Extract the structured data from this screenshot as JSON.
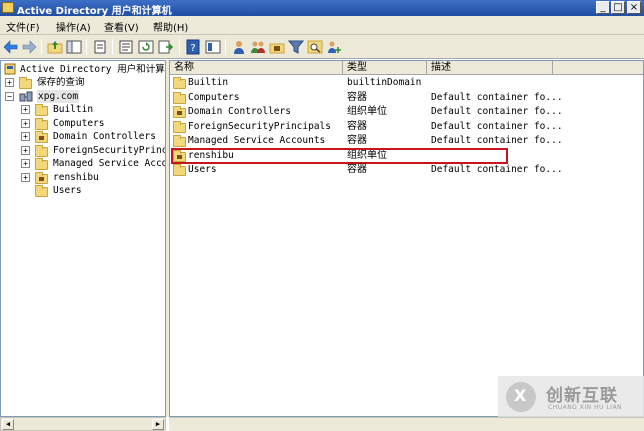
{
  "window": {
    "title": "Active Directory 用户和计算机",
    "controls": [
      "_",
      "□",
      "×"
    ]
  },
  "menu": {
    "items": [
      "文件(F)",
      "操作(A)",
      "查看(V)",
      "帮助(H)"
    ]
  },
  "toolbar": {
    "icons": [
      "back-arrow-icon",
      "forward-arrow-icon",
      "up-folder-icon",
      "show-tree-icon",
      "copy-icon",
      "properties-icon",
      "refresh-icon",
      "export-icon",
      "help-icon",
      "console-tree-icon",
      "users-icon",
      "group-icon",
      "ou-icon",
      "filter-icon",
      "find-icon",
      "add-to-group-icon"
    ]
  },
  "tree": {
    "root": "Active Directory 用户和计算机",
    "items": [
      {
        "label": "保存的查询",
        "level": 1,
        "expander": "+",
        "icon": "folder-icon"
      },
      {
        "label": "xpg.com",
        "level": 1,
        "expander": "−",
        "icon": "domain-icon"
      },
      {
        "label": "Builtin",
        "level": 2,
        "expander": "+",
        "icon": "folder-icon"
      },
      {
        "label": "Computers",
        "level": 2,
        "expander": "+",
        "icon": "folder-icon"
      },
      {
        "label": "Domain Controllers",
        "level": 2,
        "expander": "+",
        "icon": "ou-icon"
      },
      {
        "label": "ForeignSecurityPrincip",
        "level": 2,
        "expander": "+",
        "icon": "folder-icon"
      },
      {
        "label": "Managed Service Accour",
        "level": 2,
        "expander": "+",
        "icon": "folder-icon"
      },
      {
        "label": "renshibu",
        "level": 2,
        "expander": "+",
        "icon": "ou-icon"
      },
      {
        "label": "Users",
        "level": 2,
        "expander": "",
        "icon": "folder-icon"
      }
    ]
  },
  "list": {
    "columns": [
      "名称",
      "类型",
      "描述"
    ],
    "rows": [
      {
        "name": "Builtin",
        "type": "builtinDomain",
        "desc": "",
        "icon": "folder-icon"
      },
      {
        "name": "Computers",
        "type": "容器",
        "desc": "Default container fo...",
        "icon": "folder-icon"
      },
      {
        "name": "Domain Controllers",
        "type": "组织单位",
        "desc": "Default container fo...",
        "icon": "ou-icon"
      },
      {
        "name": "ForeignSecurityPrincipals",
        "type": "容器",
        "desc": "Default container fo...",
        "icon": "folder-icon"
      },
      {
        "name": "Managed Service Accounts",
        "type": "容器",
        "desc": "Default container fo...",
        "icon": "folder-icon"
      },
      {
        "name": "renshibu",
        "type": "组织单位",
        "desc": "",
        "icon": "ou-icon",
        "highlighted": true
      },
      {
        "name": "Users",
        "type": "容器",
        "desc": "Default container fo...",
        "icon": "folder-icon"
      }
    ]
  },
  "colors": {
    "highlight_border": "#c8141c",
    "titlebar": "#1f4ea3"
  },
  "watermark": {
    "main": "创新互联",
    "sub": "CHUANG XIN HU LIAN"
  }
}
